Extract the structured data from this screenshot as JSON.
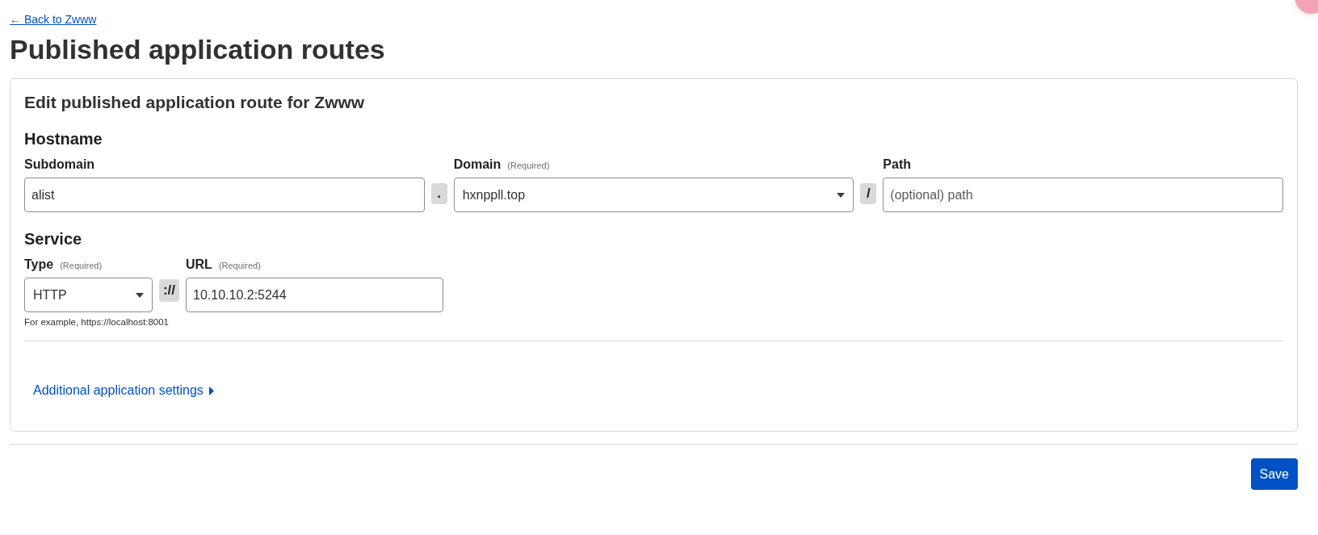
{
  "back_link": {
    "label": "← Back to Zwww"
  },
  "title": "Published application routes",
  "card": {
    "title": "Edit published application route for Zwww",
    "hostname": {
      "heading": "Hostname",
      "items": [
        {
          "kind": "input",
          "label": "Subdomain",
          "value": "alist"
        },
        {
          "kind": "separator",
          "symbol": "."
        },
        {
          "kind": "select",
          "label": "Domain",
          "note": "(Required)",
          "value": "hxnppll.top"
        },
        {
          "kind": "separator",
          "symbol": "/"
        },
        {
          "kind": "input",
          "label": "Path",
          "placeholder": "(optional) path"
        }
      ]
    },
    "service": {
      "heading": "Service",
      "items": [
        {
          "kind": "select",
          "label": "Type",
          "note": "(Required)",
          "value": "HTTP"
        },
        {
          "kind": "separator",
          "symbol": "://"
        },
        {
          "kind": "input",
          "label": "URL",
          "note": "(Required)",
          "value": "10.10.10.2:5244"
        }
      ],
      "hint": "For example, https://localhost:8001"
    },
    "additional_settings": {
      "label": "Additional application settings",
      "expanded": false
    }
  },
  "save_button": {
    "label": "Save"
  }
}
